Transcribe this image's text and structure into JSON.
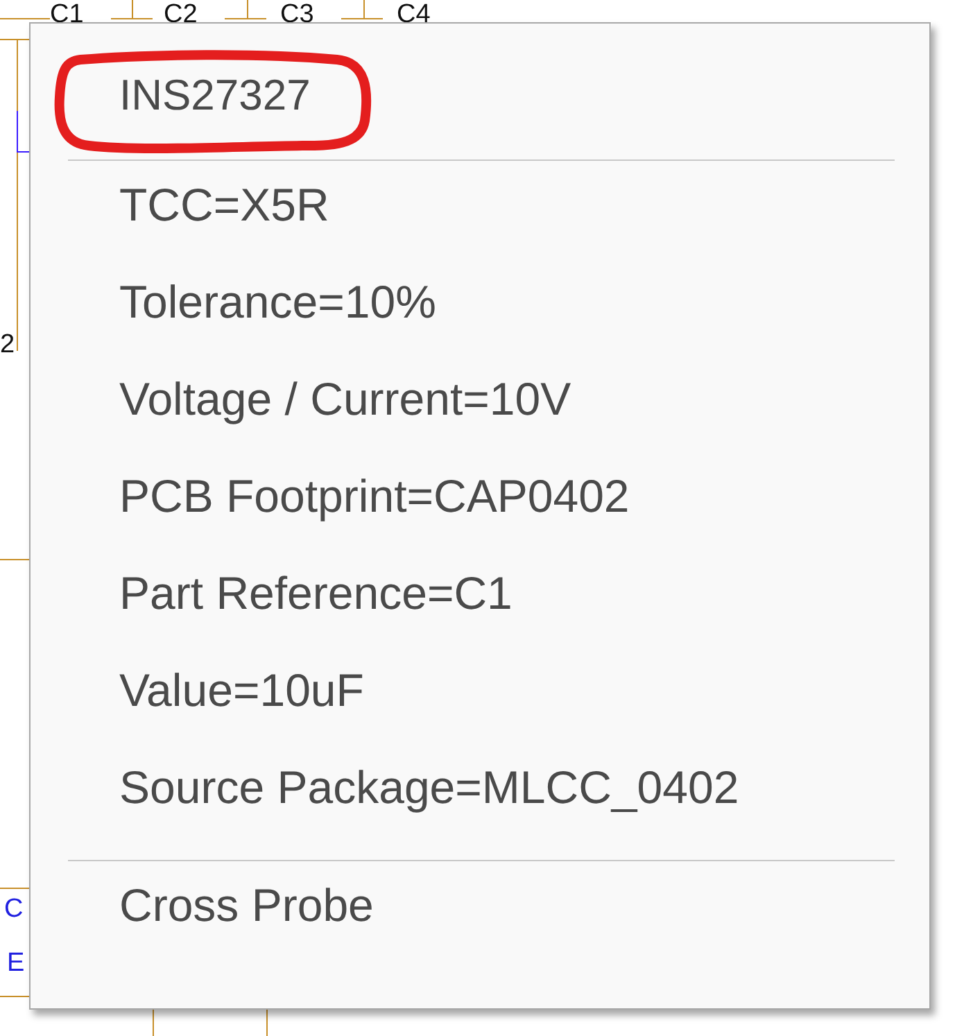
{
  "schematic": {
    "labels": [
      {
        "text": "C1",
        "kind": "ref"
      },
      {
        "text": "C2",
        "kind": "ref"
      },
      {
        "text": "C3",
        "kind": "ref"
      },
      {
        "text": "C4",
        "kind": "ref"
      },
      {
        "text": "2",
        "kind": "ref"
      },
      {
        "text": "C",
        "kind": "pin"
      },
      {
        "text": "E",
        "kind": "pin"
      }
    ]
  },
  "context_menu": {
    "header": {
      "label": "INS27327",
      "circled": true
    },
    "items": [
      {
        "label": "TCC=X5R",
        "kind": "property"
      },
      {
        "label": "Tolerance=10%",
        "kind": "property"
      },
      {
        "label": "Voltage / Current=10V",
        "kind": "property"
      },
      {
        "label": "PCB Footprint=CAP0402",
        "kind": "property"
      },
      {
        "label": "Part Reference=C1",
        "kind": "property"
      },
      {
        "label": "Value=10uF",
        "kind": "property"
      },
      {
        "label": "Source Package=MLCC_0402",
        "kind": "property"
      },
      {
        "kind": "separator"
      },
      {
        "label": "Cross Probe",
        "kind": "action"
      }
    ]
  }
}
